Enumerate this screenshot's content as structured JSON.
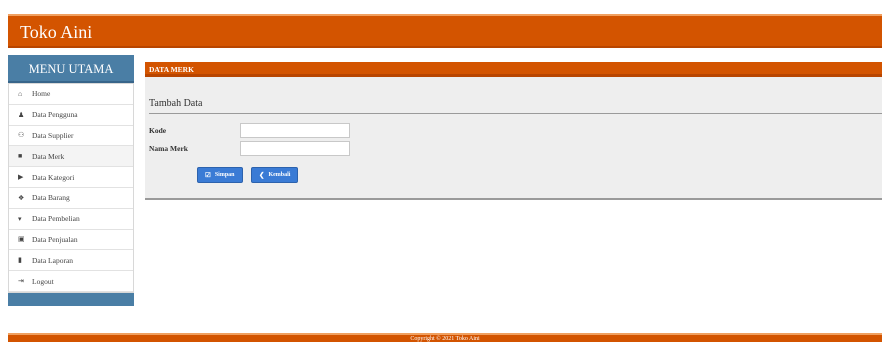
{
  "brand": "Toko Aini",
  "sidebar": {
    "title": "MENU UTAMA",
    "items": [
      {
        "icon": "home-icon",
        "glyph": "⌂",
        "label": "Home"
      },
      {
        "icon": "user-icon",
        "glyph": "♟",
        "label": "Data Pengguna"
      },
      {
        "icon": "users-icon",
        "glyph": "⚇",
        "label": "Data Supplier"
      },
      {
        "icon": "bookmark-icon",
        "glyph": "■",
        "label": "Data Merk"
      },
      {
        "icon": "tag-icon",
        "glyph": "▶",
        "label": "Data Kategori"
      },
      {
        "icon": "cubes-icon",
        "glyph": "❖",
        "label": "Data Barang"
      },
      {
        "icon": "cart-icon",
        "glyph": "▾",
        "label": "Data Pembelian"
      },
      {
        "icon": "money-icon",
        "glyph": "▣",
        "label": "Data Penjualan"
      },
      {
        "icon": "file-icon",
        "glyph": "▮",
        "label": "Data Laporan"
      },
      {
        "icon": "logout-icon",
        "glyph": "⇥",
        "label": "Logout"
      }
    ]
  },
  "panel": {
    "header": "DATA MERK",
    "subtitle": "Tambah Data",
    "fields": {
      "kode": {
        "label": "Kode",
        "value": ""
      },
      "nama_merk": {
        "label": "Nama Merk",
        "value": ""
      }
    },
    "buttons": {
      "save": {
        "label": "Simpan",
        "icon": "check-square-icon"
      },
      "back": {
        "label": "Kembali",
        "icon": "arrow-left-circle-icon"
      }
    }
  },
  "footer": "Copyright © 2021 Toko Aini",
  "colors": {
    "accent": "#d35400",
    "sidebar": "#4a7ea5",
    "button": "#3a7bd5"
  }
}
